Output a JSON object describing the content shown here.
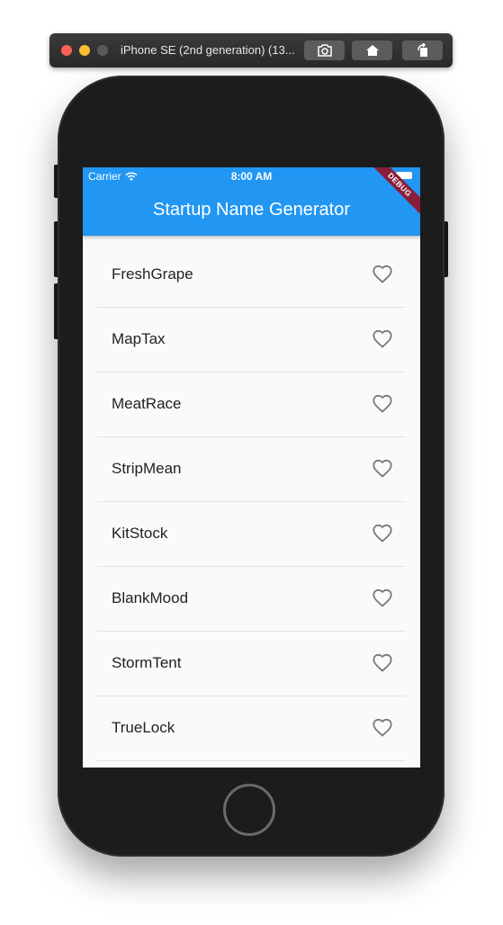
{
  "simulator": {
    "title": "iPhone SE (2nd generation) (13..."
  },
  "status_bar": {
    "carrier": "Carrier",
    "time": "8:00 AM"
  },
  "app_bar": {
    "title": "Startup Name Generator",
    "color": "#2196f3"
  },
  "debug_banner": {
    "label": "DEBUG",
    "color": "#8a1e3a"
  },
  "list": {
    "items": [
      {
        "name": "FreshGrape",
        "icon": "heart-outline-icon"
      },
      {
        "name": "MapTax",
        "icon": "heart-outline-icon"
      },
      {
        "name": "MeatRace",
        "icon": "heart-outline-icon"
      },
      {
        "name": "StripMean",
        "icon": "heart-outline-icon"
      },
      {
        "name": "KitStock",
        "icon": "heart-outline-icon"
      },
      {
        "name": "BlankMood",
        "icon": "heart-outline-icon"
      },
      {
        "name": "StormTent",
        "icon": "heart-outline-icon"
      },
      {
        "name": "TrueLock",
        "icon": "heart-outline-icon"
      }
    ]
  }
}
